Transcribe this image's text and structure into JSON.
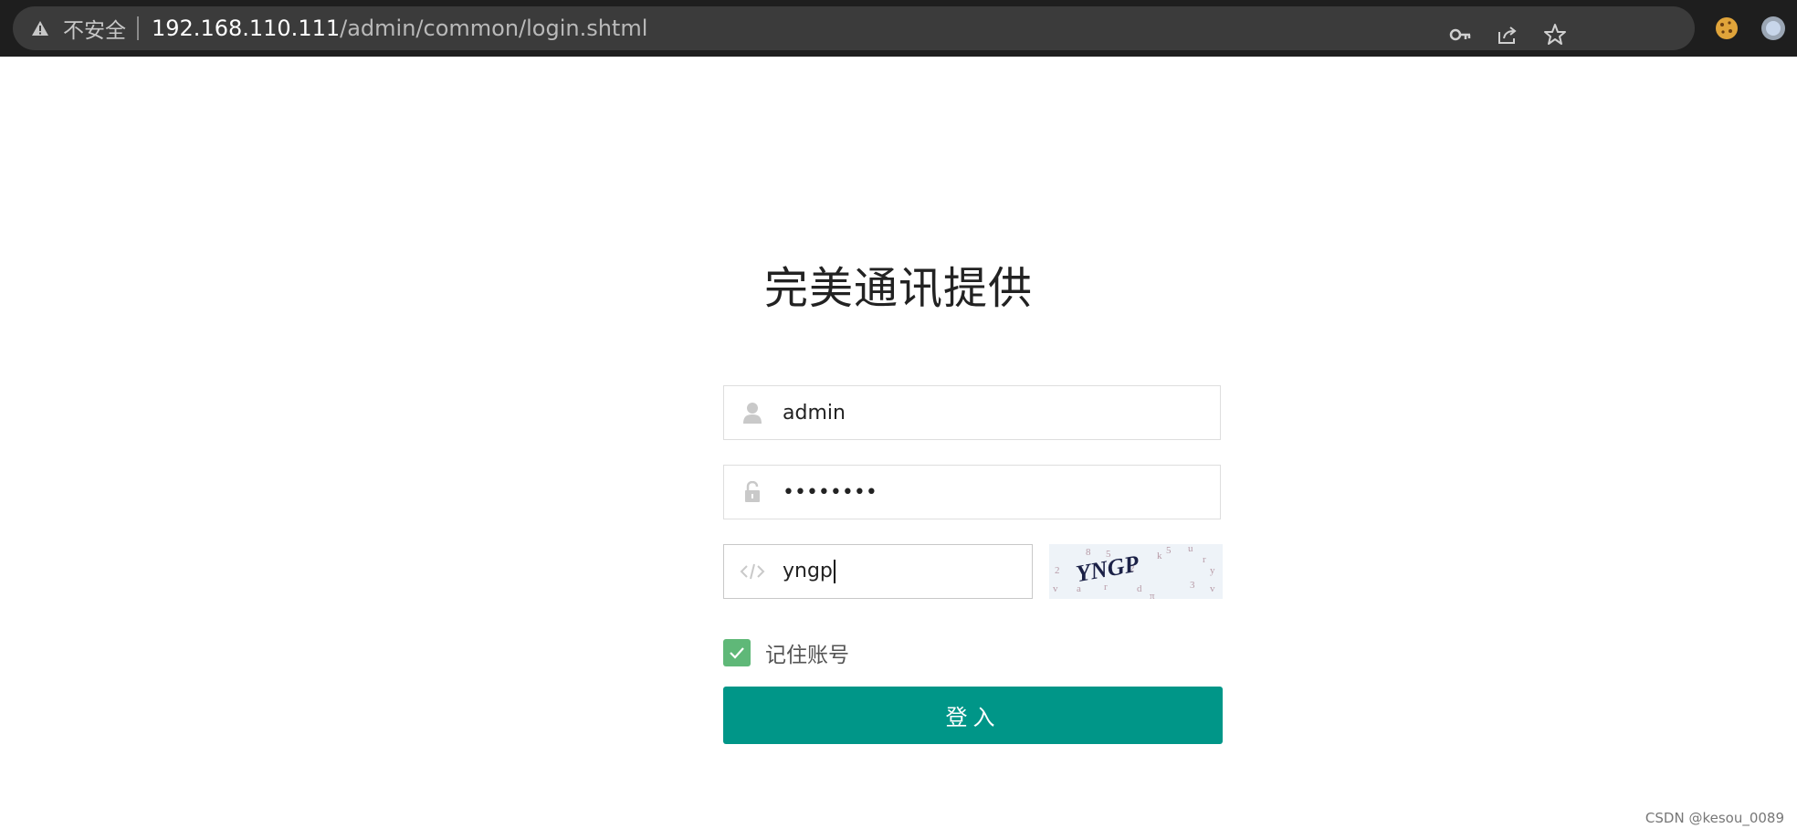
{
  "browser": {
    "insecure_label": "不安全",
    "url_host": "192.168.110.111",
    "url_path": "/admin/common/login.shtml"
  },
  "login": {
    "title": "完美通讯提供",
    "username_value": "admin",
    "password_value": "••••••••",
    "captcha_value": "yngp",
    "captcha_image_text": "YNGP",
    "remember_label": "记住账号",
    "remember_checked": true,
    "login_button_label": "登入"
  },
  "watermark": "CSDN @kesou_0089",
  "colors": {
    "primary": "#009688",
    "checkbox": "#5fb878"
  }
}
